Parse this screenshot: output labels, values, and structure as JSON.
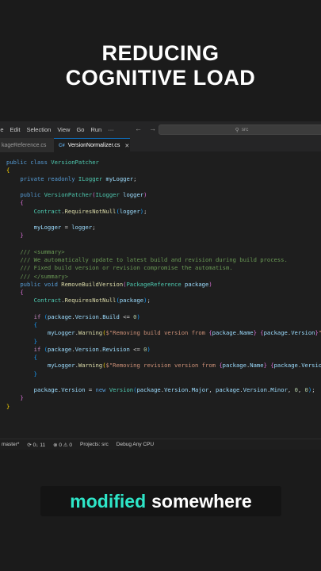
{
  "headline": {
    "line1": "REDUCING",
    "line2": "COGNITIVE LOAD"
  },
  "menubar": {
    "items": [
      "ile",
      "Edit",
      "Selection",
      "View",
      "Go",
      "Run",
      "···"
    ],
    "search_text": "src"
  },
  "tabs": [
    {
      "label": "kageReference.cs",
      "active": false
    },
    {
      "label": "VersionNormalizer.cs",
      "active": true
    }
  ],
  "code": [
    [
      [
        "kw",
        "public "
      ],
      [
        "kw",
        "class "
      ],
      [
        "ty",
        "VersionPatcher"
      ]
    ],
    [
      [
        "br1",
        "{"
      ]
    ],
    [
      [
        "pn",
        "    "
      ],
      [
        "kw",
        "private "
      ],
      [
        "kw",
        "readonly "
      ],
      [
        "ty",
        "ILogger "
      ],
      [
        "va",
        "myLogger"
      ],
      [
        "pn",
        ";"
      ]
    ],
    [],
    [
      [
        "pn",
        "    "
      ],
      [
        "kw",
        "public "
      ],
      [
        "ty",
        "VersionPatcher"
      ],
      [
        "br2",
        "("
      ],
      [
        "ty",
        "ILogger "
      ],
      [
        "va",
        "logger"
      ],
      [
        "br2",
        ")"
      ]
    ],
    [
      [
        "pn",
        "    "
      ],
      [
        "br2",
        "{"
      ]
    ],
    [
      [
        "pn",
        "        "
      ],
      [
        "ty",
        "Contract"
      ],
      [
        "pn",
        "."
      ],
      [
        "fn",
        "RequiresNotNull"
      ],
      [
        "br3",
        "("
      ],
      [
        "va",
        "logger"
      ],
      [
        "br3",
        ")"
      ],
      [
        "pn",
        ";"
      ]
    ],
    [],
    [
      [
        "pn",
        "        "
      ],
      [
        "va",
        "myLogger"
      ],
      [
        "pn",
        " = "
      ],
      [
        "va",
        "logger"
      ],
      [
        "pn",
        ";"
      ]
    ],
    [
      [
        "pn",
        "    "
      ],
      [
        "br2",
        "}"
      ]
    ],
    [],
    [
      [
        "pn",
        "    "
      ],
      [
        "cm",
        "/// <summary>"
      ]
    ],
    [
      [
        "pn",
        "    "
      ],
      [
        "cm",
        "/// We automatically update to latest build and revision during build process."
      ]
    ],
    [
      [
        "pn",
        "    "
      ],
      [
        "cm",
        "/// Fixed build version or revision compromise the automatism."
      ]
    ],
    [
      [
        "pn",
        "    "
      ],
      [
        "cm",
        "/// </summary>"
      ]
    ],
    [
      [
        "pn",
        "    "
      ],
      [
        "kw",
        "public "
      ],
      [
        "kw",
        "void "
      ],
      [
        "fn",
        "RemoveBuildVersion"
      ],
      [
        "br2",
        "("
      ],
      [
        "ty",
        "PackageReference "
      ],
      [
        "va",
        "package"
      ],
      [
        "br2",
        ")"
      ]
    ],
    [
      [
        "pn",
        "    "
      ],
      [
        "br2",
        "{"
      ]
    ],
    [
      [
        "pn",
        "        "
      ],
      [
        "ty",
        "Contract"
      ],
      [
        "pn",
        "."
      ],
      [
        "fn",
        "RequiresNotNull"
      ],
      [
        "br3",
        "("
      ],
      [
        "va",
        "package"
      ],
      [
        "br3",
        ")"
      ],
      [
        "pn",
        ";"
      ]
    ],
    [],
    [
      [
        "pn",
        "        "
      ],
      [
        "ct",
        "if "
      ],
      [
        "br3",
        "("
      ],
      [
        "va",
        "package"
      ],
      [
        "pn",
        "."
      ],
      [
        "va",
        "Version"
      ],
      [
        "pn",
        "."
      ],
      [
        "va",
        "Build"
      ],
      [
        "pn",
        " <= "
      ],
      [
        "nu",
        "0"
      ],
      [
        "br3",
        ")"
      ]
    ],
    [
      [
        "pn",
        "        "
      ],
      [
        "br3",
        "{"
      ]
    ],
    [
      [
        "pn",
        "            "
      ],
      [
        "va",
        "myLogger"
      ],
      [
        "pn",
        "."
      ],
      [
        "fn",
        "Warning"
      ],
      [
        "br1",
        "("
      ],
      [
        "st",
        "$\"Removing build version from "
      ],
      [
        "br2",
        "{"
      ],
      [
        "va",
        "package"
      ],
      [
        "pn",
        "."
      ],
      [
        "va",
        "Name"
      ],
      [
        "br2",
        "}"
      ],
      [
        "st",
        " "
      ],
      [
        "br2",
        "{"
      ],
      [
        "va",
        "package"
      ],
      [
        "pn",
        "."
      ],
      [
        "va",
        "Version"
      ],
      [
        "br2",
        "}"
      ],
      [
        "st",
        "\""
      ],
      [
        "br1",
        ")"
      ],
      [
        "pn",
        ";"
      ]
    ],
    [
      [
        "pn",
        "        "
      ],
      [
        "br3",
        "}"
      ]
    ],
    [
      [
        "pn",
        "        "
      ],
      [
        "ct",
        "if "
      ],
      [
        "br3",
        "("
      ],
      [
        "va",
        "package"
      ],
      [
        "pn",
        "."
      ],
      [
        "va",
        "Version"
      ],
      [
        "pn",
        "."
      ],
      [
        "va",
        "Revision"
      ],
      [
        "pn",
        " <= "
      ],
      [
        "nu",
        "0"
      ],
      [
        "br3",
        ")"
      ]
    ],
    [
      [
        "pn",
        "        "
      ],
      [
        "br3",
        "{"
      ]
    ],
    [
      [
        "pn",
        "            "
      ],
      [
        "va",
        "myLogger"
      ],
      [
        "pn",
        "."
      ],
      [
        "fn",
        "Warning"
      ],
      [
        "br1",
        "("
      ],
      [
        "st",
        "$\"Removing revision version from "
      ],
      [
        "br2",
        "{"
      ],
      [
        "va",
        "package"
      ],
      [
        "pn",
        "."
      ],
      [
        "va",
        "Name"
      ],
      [
        "br2",
        "}"
      ],
      [
        "st",
        " "
      ],
      [
        "br2",
        "{"
      ],
      [
        "va",
        "package"
      ],
      [
        "pn",
        "."
      ],
      [
        "va",
        "Version"
      ],
      [
        "br2",
        "}"
      ],
      [
        "st",
        "\""
      ],
      [
        "br1",
        ")"
      ],
      [
        "pn",
        ";"
      ]
    ],
    [
      [
        "pn",
        "        "
      ],
      [
        "br3",
        "}"
      ]
    ],
    [],
    [
      [
        "pn",
        "        "
      ],
      [
        "va",
        "package"
      ],
      [
        "pn",
        "."
      ],
      [
        "va",
        "Version"
      ],
      [
        "pn",
        " = "
      ],
      [
        "kw",
        "new "
      ],
      [
        "ty",
        "Version"
      ],
      [
        "br3",
        "("
      ],
      [
        "va",
        "package"
      ],
      [
        "pn",
        "."
      ],
      [
        "va",
        "Version"
      ],
      [
        "pn",
        "."
      ],
      [
        "va",
        "Major"
      ],
      [
        "pn",
        ", "
      ],
      [
        "va",
        "package"
      ],
      [
        "pn",
        "."
      ],
      [
        "va",
        "Version"
      ],
      [
        "pn",
        "."
      ],
      [
        "va",
        "Minor"
      ],
      [
        "pn",
        ", "
      ],
      [
        "nu",
        "0"
      ],
      [
        "pn",
        ", "
      ],
      [
        "nu",
        "0"
      ],
      [
        "br3",
        ")"
      ],
      [
        "pn",
        ";"
      ]
    ],
    [
      [
        "pn",
        "    "
      ],
      [
        "br2",
        "}"
      ]
    ],
    [
      [
        "br1",
        "}"
      ]
    ]
  ],
  "colors": {
    "keyword": "#569cd6",
    "type": "#4ec9b0",
    "method": "#dcdcaa",
    "variable": "#9cdcfe",
    "string": "#ce9178",
    "number": "#b5cea8",
    "comment": "#6a9955",
    "control": "#c586c0",
    "caption_highlight": "#2ee6c8"
  },
  "statusbar": {
    "branch": "master*",
    "sync": "0↓ 11",
    "problems": "⊗ 0 ⚠ 0",
    "projects": "Projects: src",
    "config": "Debug Any CPU"
  },
  "caption": {
    "highlight": "modified",
    "rest": "somewhere"
  }
}
